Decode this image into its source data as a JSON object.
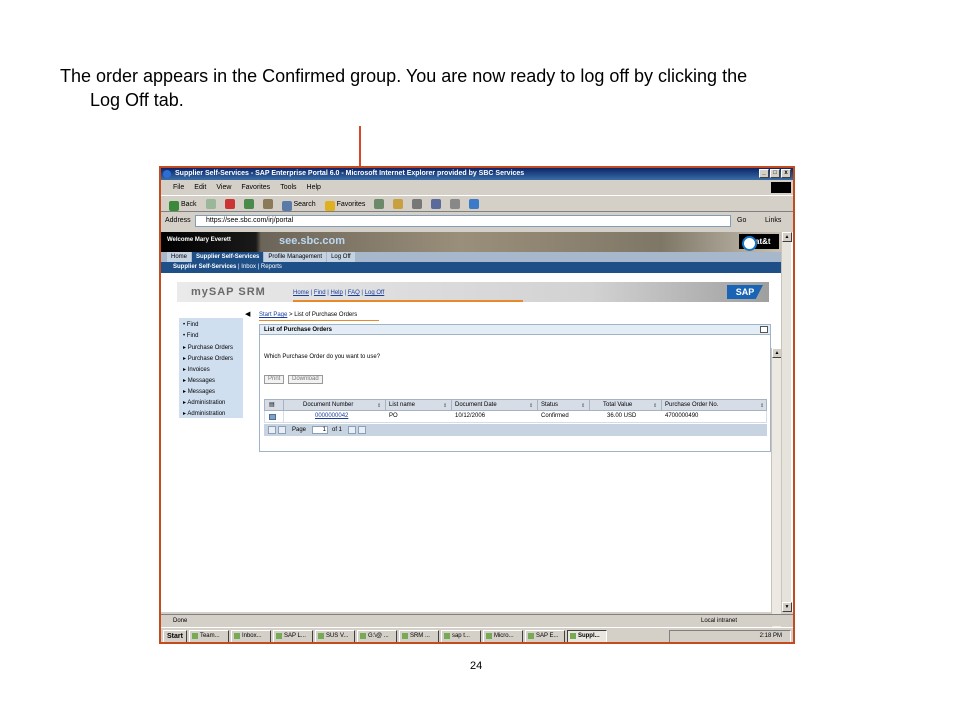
{
  "caption": {
    "line1": "The order appears in the Confirmed group.  You are now ready to log off by clicking the",
    "line2": "Log Off tab."
  },
  "page_number": "24",
  "arrow_color": "#d9462a",
  "browser": {
    "window_title": "Supplier Self-Services - SAP Enterprise Portal 6.0 - Microsoft Internet Explorer provided by SBC Services",
    "window_buttons": [
      "_",
      "□",
      "x"
    ],
    "menu": [
      "File",
      "Edit",
      "View",
      "Favorites",
      "Tools",
      "Help"
    ],
    "toolbar": {
      "back": "Back",
      "search": "Search",
      "favorites": "Favorites"
    },
    "address_label": "Address",
    "address": "https://see.sbc.com/irj/portal",
    "go": "Go",
    "links": "Links",
    "status": "Done",
    "zone": "Local intranet"
  },
  "portal": {
    "welcome": "Welcome Mary Everett",
    "site": "see.sbc.com",
    "brand": "at&t",
    "tabs": [
      "Home",
      "Supplier Self-Services",
      "Profile Management",
      "Log Off"
    ],
    "active_tab": "Supplier Self-Services",
    "subnav": {
      "current": "Supplier Self-Services",
      "sep1": "|",
      "item2": "Inbox",
      "sep2": "|",
      "item3": "Reports"
    }
  },
  "srm": {
    "logo": "mySAP SRM",
    "links": [
      "Home",
      "Find",
      "Help",
      "FAQ",
      "Log Off"
    ],
    "sap_logo": "SAP",
    "left_nav": [
      {
        "bullet": "•",
        "label": "Find"
      },
      {
        "bullet": "•",
        "label": "Find"
      },
      {
        "bullet": "▸",
        "label": "Purchase Orders"
      },
      {
        "bullet": "▸",
        "label": "Purchase Orders"
      },
      {
        "bullet": "▸",
        "label": "Invoices"
      },
      {
        "bullet": "▸",
        "label": "Messages"
      },
      {
        "bullet": "▸",
        "label": "Messages"
      },
      {
        "bullet": "▸",
        "label": "Administration"
      },
      {
        "bullet": "▸",
        "label": "Administration"
      }
    ],
    "breadcrumb": {
      "start": "Start Page",
      "sep": ">",
      "current": "List of Purchase Orders"
    },
    "panel_title": "List of Purchase Orders",
    "question": "Which Purchase Order do you want to use?",
    "buttons": {
      "print": "Print",
      "download": "Download"
    },
    "table": {
      "columns": [
        "Document Number",
        "List name",
        "Document Date",
        "Status",
        "Total Value",
        "Purchase Order No."
      ],
      "rows": [
        {
          "doc_no": "0000000042",
          "list_name": "PO",
          "date": "10/12/2006",
          "status": "Confirmed",
          "total": "36.00 USD",
          "po_no": "4700000490"
        }
      ],
      "pager": {
        "label": "Page",
        "page": "1",
        "of": "of 1"
      }
    }
  },
  "taskbar": {
    "start": "Start",
    "items": [
      "Team...",
      "Inbox...",
      "SAP L...",
      "SUS V...",
      "G:\\@ ...",
      "SRM ...",
      "sap t...",
      "Micro...",
      "SAP E...",
      "Suppl..."
    ],
    "active_item": "Suppl...",
    "clock": "2:18 PM"
  }
}
